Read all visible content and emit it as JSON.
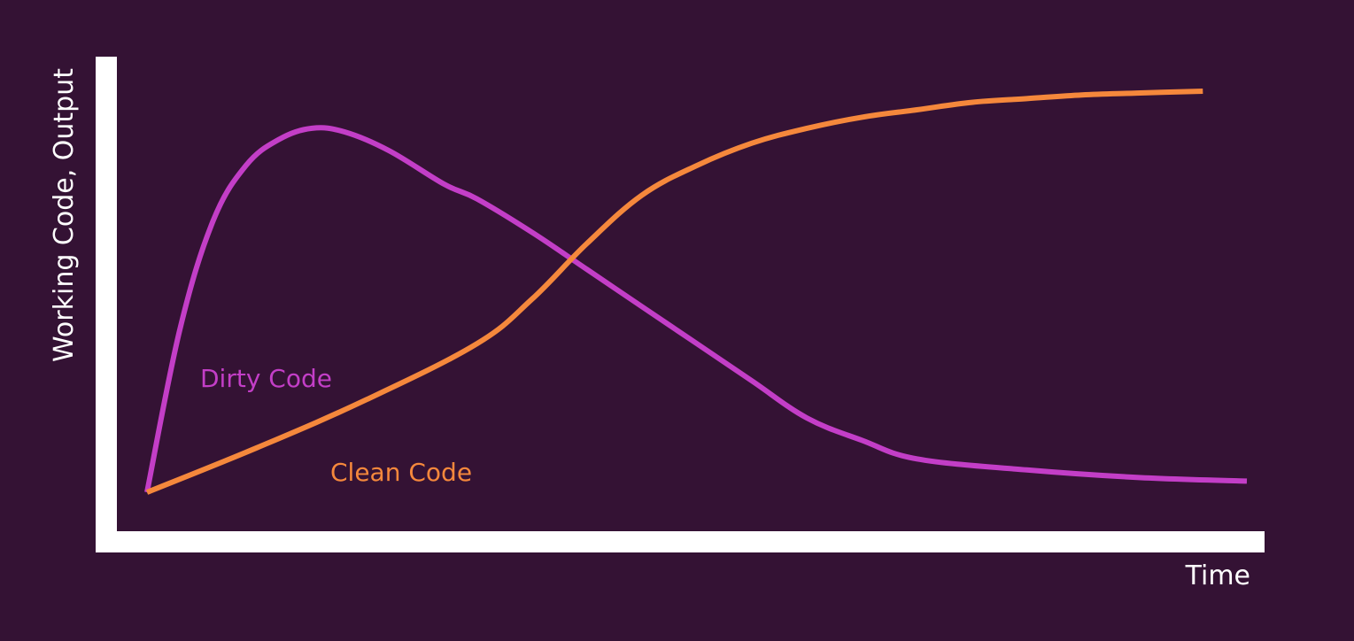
{
  "chart_data": {
    "type": "line",
    "title": "",
    "xlabel": "Time",
    "ylabel": "Working Code, Output",
    "xlim": [
      0,
      100
    ],
    "ylim": [
      0,
      100
    ],
    "grid": false,
    "legend": "none",
    "series": [
      {
        "name": "Dirty Code",
        "color": "#c33ec7",
        "x": [
          0,
          3,
          6,
          9,
          12,
          15,
          18,
          22,
          27,
          30,
          35,
          40,
          45,
          50,
          55,
          60,
          65,
          70,
          80,
          90,
          100
        ],
        "y": [
          0,
          44,
          73,
          88,
          95,
          98,
          97,
          92,
          83,
          79,
          70,
          60,
          50,
          40,
          30,
          20,
          14,
          9,
          6,
          4,
          3
        ]
      },
      {
        "name": "Clean Code",
        "color": "#f5883c",
        "x": [
          0,
          10,
          20,
          30,
          35,
          40,
          45,
          50,
          55,
          60,
          65,
          70,
          75,
          80,
          85,
          90,
          96
        ],
        "y": [
          0,
          12,
          25,
          40,
          52,
          67,
          80,
          88,
          94,
          98,
          101,
          103,
          105,
          106,
          107,
          107.5,
          108
        ]
      }
    ]
  }
}
